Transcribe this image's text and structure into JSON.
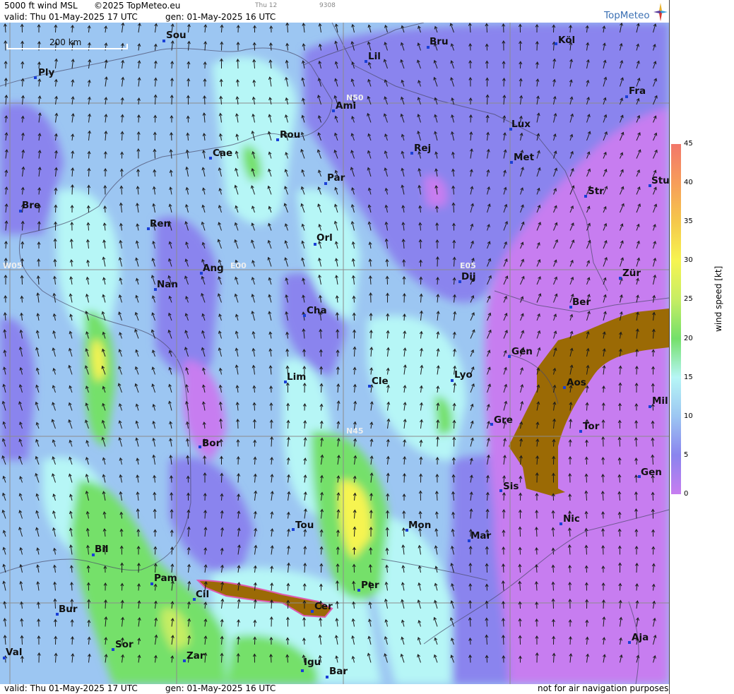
{
  "header": {
    "product": "5000 ft wind MSL",
    "copyright": "©2025 TopMeteo.eu",
    "small_day": "Thu 12",
    "small_code": "9308",
    "valid": "valid:  Thu  01-May-2025  17 UTC",
    "gen": "gen: 01-May-2025 16 UTC"
  },
  "footer": {
    "valid": "valid:  Thu  01-May-2025  17 UTC",
    "gen": "gen: 01-May-2025 16 UTC",
    "disclaimer": "not for air navigation purposes"
  },
  "logo": {
    "text": "TopMeteo",
    "icon": "compass-star-icon"
  },
  "scale_bar": {
    "label": "200 km"
  },
  "grid_labels": [
    "N50",
    "N45",
    "W05",
    "E00",
    "E05"
  ],
  "cities": [
    "Sou",
    "Bru",
    "Köl",
    "Lil",
    "Ply",
    "Ami",
    "Fra",
    "Lux",
    "Rou",
    "Cae",
    "Rej",
    "Met",
    "Par",
    "Stu",
    "Bre",
    "Str",
    "Ren",
    "Orl",
    "Ang",
    "Nan",
    "Dij",
    "Zür",
    "Cha",
    "Ber",
    "Gen",
    "Lim",
    "Cle",
    "Lyo",
    "Aos",
    "Mil",
    "Bor",
    "Gre",
    "Tor",
    "Gen",
    "Sis",
    "Nic",
    "Tou",
    "Mon",
    "Mar",
    "Bil",
    "Pam",
    "Cil",
    "Per",
    "Bur",
    "Cer",
    "Sor",
    "Aja",
    "Val",
    "Zar",
    "Igu",
    "Bar"
  ],
  "legend": {
    "title": "wind speed [kt]",
    "ticks": [
      "45",
      "40",
      "35",
      "30",
      "25",
      "20",
      "15",
      "10",
      "5",
      "0"
    ],
    "colors": [
      "#f2776a",
      "#f79d5a",
      "#f5c84b",
      "#f6f451",
      "#c6ed64",
      "#74e06a",
      "#b6f6f6",
      "#9cc6f2",
      "#8a84ee",
      "#c77df0"
    ]
  },
  "colors": {
    "calm_purple": "#c77df0",
    "light_violet": "#8a84ee",
    "light_blue": "#9cc6f2",
    "cyan": "#b6f6f6",
    "green": "#74e06a",
    "terrain_brown": "#9b6a05",
    "grid": "#8c8c8c",
    "arrow": "#1b1b1b",
    "city_dot": "#1a3fd6"
  }
}
